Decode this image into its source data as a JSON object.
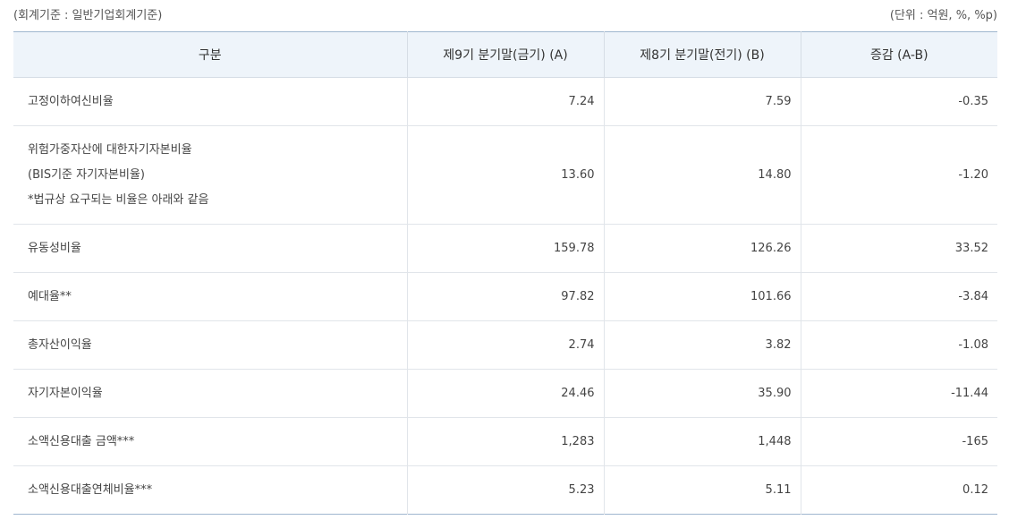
{
  "meta": {
    "standard": "(회계기준 : 일반기업회계기준)",
    "unit": "(단위 : 억원, %, %p)"
  },
  "table": {
    "headers": [
      "구분",
      "제9기 분기말(금기) (A)",
      "제8기 분기말(전기) (B)",
      "증감 (A-B)"
    ],
    "rows": [
      {
        "label": [
          "고정이하여신비율"
        ],
        "current": "7.24",
        "previous": "7.59",
        "change": "-0.35"
      },
      {
        "label": [
          "위험가중자산에 대한자기자본비율",
          "(BIS기준 자기자본비율)",
          "*법규상 요구되는 비율은 아래와 같음"
        ],
        "current": "13.60",
        "previous": "14.80",
        "change": "-1.20"
      },
      {
        "label": [
          "유동성비율"
        ],
        "current": "159.78",
        "previous": "126.26",
        "change": "33.52"
      },
      {
        "label": [
          "예대율**"
        ],
        "current": "97.82",
        "previous": "101.66",
        "change": "-3.84"
      },
      {
        "label": [
          "총자산이익율"
        ],
        "current": "2.74",
        "previous": "3.82",
        "change": "-1.08"
      },
      {
        "label": [
          "자기자본이익율"
        ],
        "current": "24.46",
        "previous": "35.90",
        "change": "-11.44"
      },
      {
        "label": [
          "소액신용대출 금액***"
        ],
        "current": "1,283",
        "previous": "1,448",
        "change": "-165"
      },
      {
        "label": [
          "소액신용대출연체비율***"
        ],
        "current": "5.23",
        "previous": "5.11",
        "change": "0.12"
      }
    ]
  }
}
